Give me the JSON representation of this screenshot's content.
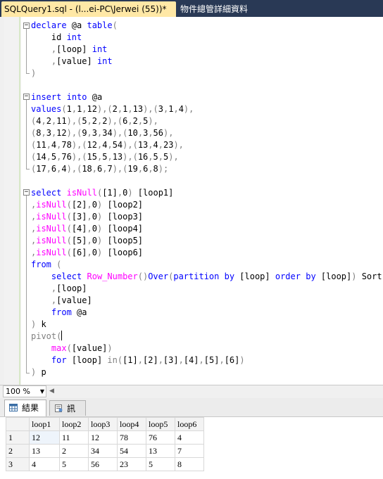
{
  "tabs": {
    "active_label": "SQLQuery1.sql - (l...ei-PC\\Jerwei (55))*",
    "inactive_label": "物件總管詳細資料"
  },
  "status": {
    "zoom": "100 %"
  },
  "results_tabs": {
    "results_label": "結果",
    "messages_label": "訊息"
  },
  "grid": {
    "columns": [
      "loop1",
      "loop2",
      "loop3",
      "loop4",
      "loop5",
      "loop6"
    ],
    "rows": [
      {
        "num": "1",
        "cells": [
          "12",
          "11",
          "12",
          "78",
          "76",
          "4"
        ]
      },
      {
        "num": "2",
        "cells": [
          "13",
          "2",
          "34",
          "54",
          "13",
          "7"
        ]
      },
      {
        "num": "3",
        "cells": [
          "4",
          "5",
          "56",
          "23",
          "5",
          "8"
        ]
      }
    ]
  },
  "colors": {
    "tab_bar": "#293955",
    "active_tab": "#ffe8a6",
    "keyword": "#0000ff",
    "function": "#ff00ff",
    "operator": "#808080"
  }
}
